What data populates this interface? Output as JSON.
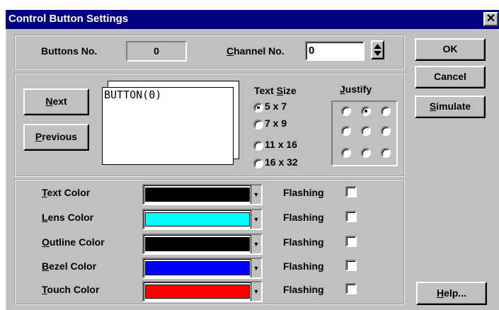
{
  "window": {
    "title": "Control Button Settings",
    "close_glyph": "✕"
  },
  "top": {
    "buttons_no_label": "Buttons No.",
    "buttons_no_value": "0",
    "channel_label_u": "C",
    "channel_label_rest": "hannel No.",
    "channel_value": "0",
    "spinner_icon": "up-down-arrows"
  },
  "side_buttons": {
    "ok": "OK",
    "cancel": "Cancel",
    "simulate_u": "S",
    "simulate_rest": "imulate",
    "help_u": "H",
    "help_rest": "elp..."
  },
  "nav": {
    "next_u": "N",
    "next_rest": "ext",
    "previous_u": "P",
    "previous_rest": "revious"
  },
  "preview": {
    "text": "BUTTON(0)"
  },
  "text_size": {
    "label_pre": "Text ",
    "label_u": "S",
    "label_rest": "ize",
    "options": [
      "5 x 7",
      "7 x 9",
      "11 x 16",
      "16 x 32"
    ],
    "selected": "5 x 7"
  },
  "justify": {
    "label_u": "J",
    "label_rest": "ustify",
    "selected_position": "top-center"
  },
  "colors": [
    {
      "label_u": "T",
      "label_rest": "ext Color",
      "color": "#000000",
      "flashing_label": "Flashing",
      "flashing": false
    },
    {
      "label_u": "L",
      "label_rest": "ens Color",
      "color": "#00ffff",
      "flashing_label": "Flashing",
      "flashing": false
    },
    {
      "label_u": "O",
      "label_rest": "utline Color",
      "color": "#000000",
      "flashing_label": "Flashing",
      "flashing": false
    },
    {
      "label_u": "B",
      "label_rest": "ezel Color",
      "color": "#0000ff",
      "flashing_label": "Flashing",
      "flashing": false
    },
    {
      "label_u": "T",
      "label_rest": "ouch Color",
      "color": "#ff0000",
      "flashing_label": "Flashing",
      "flashing": false
    }
  ],
  "theme": {
    "face": "#c0c0c0",
    "titlebar": "#000080"
  }
}
